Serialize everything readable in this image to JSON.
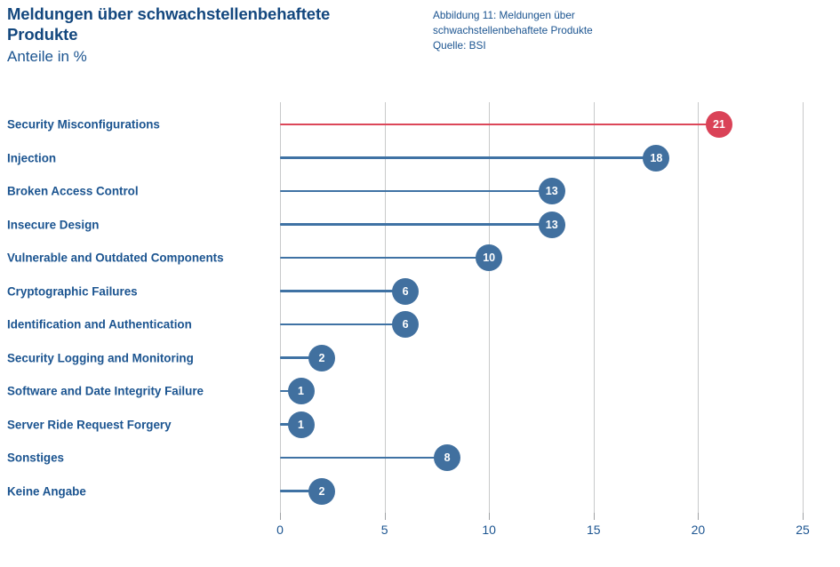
{
  "header": {
    "title_line1": "Meldungen über schwachstellenbehaftete",
    "title_line2": "Produkte",
    "subtitle": "Anteile in %"
  },
  "caption": {
    "line1": "Abbildung 11: Meldungen über",
    "line2": "schwachstellenbehaftete Produkte",
    "line3": "Quelle: BSI"
  },
  "colors": {
    "text_blue": "#1b5490",
    "title_blue": "#13477e",
    "marker_blue": "#41709f",
    "marker_red": "#da4257",
    "stem_blue": "#3f72a4",
    "stem_red": "#dc4759",
    "gridline": "#c8c9ca"
  },
  "chart_data": {
    "type": "bar",
    "title": "Meldungen über schwachstellenbehaftete Produkte",
    "subtitle": "Anteile in %",
    "xlabel": "",
    "ylabel": "",
    "xlim": [
      0,
      25
    ],
    "xticks": [
      0,
      5,
      10,
      15,
      20,
      25
    ],
    "xtick_labels": [
      "0",
      "5",
      "10",
      "15",
      "20",
      "25"
    ],
    "grid": true,
    "legend": false,
    "orientation": "horizontal",
    "style": "lollipop",
    "categories": [
      "Security Misconfigurations",
      "Injection",
      "Broken Access Control",
      "Insecure Design",
      "Vulnerable and Outdated Components",
      "Cryptographic Failures",
      "Identification and Authentication",
      "Security Logging and Monitoring",
      "Software and Date Integrity Failure",
      "Server Ride Request Forgery",
      "Sonstiges",
      "Keine Angabe"
    ],
    "values": [
      21,
      18,
      13,
      13,
      10,
      6,
      6,
      2,
      1,
      1,
      8,
      2
    ],
    "value_labels": [
      "21",
      "18",
      "13",
      "13",
      "10",
      "6",
      "6",
      "2",
      "1",
      "1",
      "8",
      "2"
    ],
    "highlighted": [
      true,
      false,
      false,
      false,
      false,
      false,
      false,
      false,
      false,
      false,
      false,
      false
    ],
    "source": "Quelle: BSI"
  }
}
